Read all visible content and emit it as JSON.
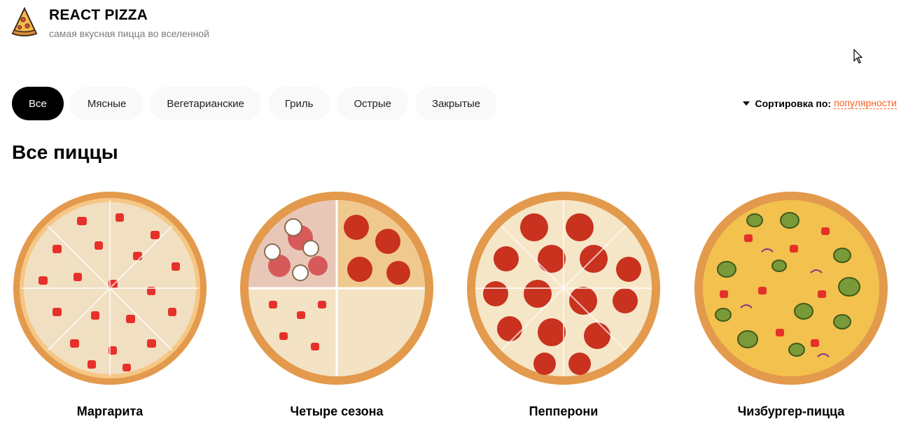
{
  "header": {
    "title": "REACT PIZZA",
    "subtitle": "самая вкусная пицца во вселенной",
    "logo_icon": "pizza-slice-icon"
  },
  "categories": [
    {
      "label": "Все",
      "active": true
    },
    {
      "label": "Мясные",
      "active": false
    },
    {
      "label": "Вегетарианские",
      "active": false
    },
    {
      "label": "Гриль",
      "active": false
    },
    {
      "label": "Острые",
      "active": false
    },
    {
      "label": "Закрытые",
      "active": false
    }
  ],
  "sort": {
    "label": "Сортировка по:",
    "value": "популярности"
  },
  "section_title": "Все пиццы",
  "pizzas": [
    {
      "name": "Маргарита",
      "image": "pizza-margherita-image"
    },
    {
      "name": "Четыре сезона",
      "image": "pizza-four-seasons-image"
    },
    {
      "name": "Пепперони",
      "image": "pizza-pepperoni-image"
    },
    {
      "name": "Чизбургер-пицца",
      "image": "pizza-cheeseburger-image"
    }
  ],
  "colors": {
    "accent": "#fe5f1e",
    "active_bg": "#000000",
    "chip_bg": "#f9f9f9"
  }
}
